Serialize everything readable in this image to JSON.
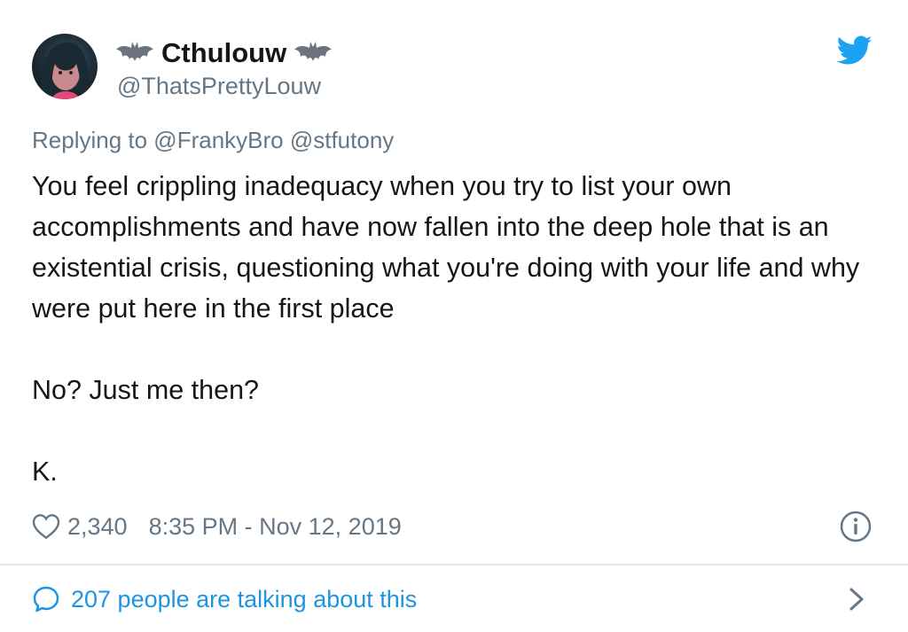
{
  "user": {
    "display_name": "Cthulouw",
    "handle": "@ThatsPrettyLouw",
    "avatar_icon": "avatar-icon",
    "emoji_icon": "bat-icon"
  },
  "brand": {
    "icon": "twitter-bird-icon",
    "color": "#1da1f2"
  },
  "reply": {
    "text": "Replying to @FrankyBro @stfutony"
  },
  "tweet": {
    "paragraphs": [
      "You feel crippling inadequacy when you try to list your own accomplishments and have now fallen into the deep hole that is an existential crisis, questioning what you're doing with your life and why were put here in the first place",
      "No? Just me then?",
      "K."
    ]
  },
  "meta": {
    "likes": "2,340",
    "timestamp": "8:35 PM - Nov 12, 2019",
    "like_icon": "heart-icon",
    "info_icon": "info-icon"
  },
  "footer": {
    "talking_text": "207 people are talking about this",
    "bubble_icon": "speech-bubble-icon",
    "chevron_icon": "chevron-right-icon",
    "link_color": "#1b95e0"
  },
  "colors": {
    "text": "#14171a",
    "muted": "#657786",
    "divider": "#e1e8ed"
  }
}
